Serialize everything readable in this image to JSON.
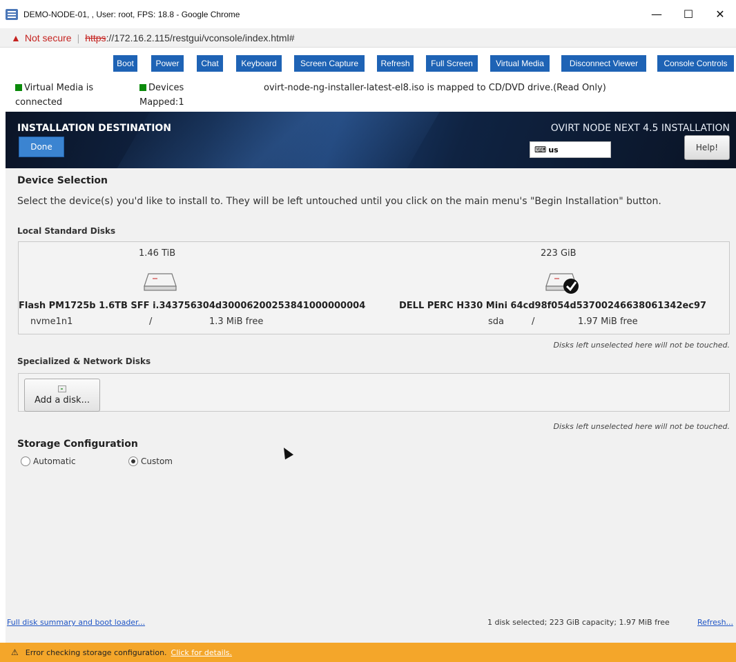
{
  "window": {
    "title": "DEMO-NODE-01, , User: root, FPS: 18.8 - Google Chrome",
    "minimize": "—",
    "maximize": "☐",
    "close": "✕"
  },
  "urlbar": {
    "warning": "Not secure",
    "separator": "|",
    "protocol": "https",
    "rest": "://172.16.2.115/restgui/vconsole/index.html#"
  },
  "toolbar": {
    "buttons": [
      "Boot",
      "Power",
      "Chat",
      "Keyboard",
      "Screen Capture",
      "Refresh",
      "Full Screen",
      "Virtual Media",
      "Disconnect Viewer",
      "Console Controls"
    ]
  },
  "status": {
    "virtual_media_line1": "Virtual Media is",
    "virtual_media_line2": "connected",
    "devices_line1": "Devices",
    "devices_line2": "Mapped:1",
    "iso_message": "ovirt-node-ng-installer-latest-el8.iso is mapped to CD/DVD drive.(Read Only)",
    "indicator_color": "#0a8a0a"
  },
  "installer": {
    "screen_title": "INSTALLATION DESTINATION",
    "done_label": "Done",
    "product": "OVIRT NODE NEXT 4.5 INSTALLATION",
    "keyboard_layout": "us",
    "help_label": "Help!"
  },
  "device_selection": {
    "heading": "Device Selection",
    "description": "Select the device(s) you'd like to install to.  They will be left untouched until you click on the main menu's \"Begin Installation\" button.",
    "local_heading": "Local Standard Disks",
    "disks": [
      {
        "size": "1.46 TiB",
        "name": "Flash PM1725b 1.6TB SFF i.343756304d30006200253841000000004",
        "device": "nvme1n1",
        "sep": "/",
        "free": "1.3 MiB free",
        "selected": false
      },
      {
        "size": "223 GiB",
        "name": "DELL PERC H330 Mini 64cd98f054d53700246638061342ec97",
        "device": "sda",
        "sep": "/",
        "free": "1.97 MiB free",
        "selected": true
      }
    ],
    "untouched_hint": "Disks left unselected here will not be touched.",
    "network_heading": "Specialized & Network Disks",
    "add_disk_label": "Add a disk...",
    "untouched_hint_2": "Disks left unselected here will not be touched."
  },
  "storage": {
    "heading": "Storage Configuration",
    "automatic_label": "Automatic",
    "custom_label": "Custom",
    "selected": "custom"
  },
  "footer": {
    "summary_link": "Full disk summary and boot loader...",
    "selection_summary": "1 disk selected; 223 GiB capacity; 1.97 MiB free",
    "refresh_link": "Refresh..."
  },
  "error_bar": {
    "message": "Error checking storage configuration.",
    "link": "Click for details.",
    "color": "#f4a62a"
  }
}
